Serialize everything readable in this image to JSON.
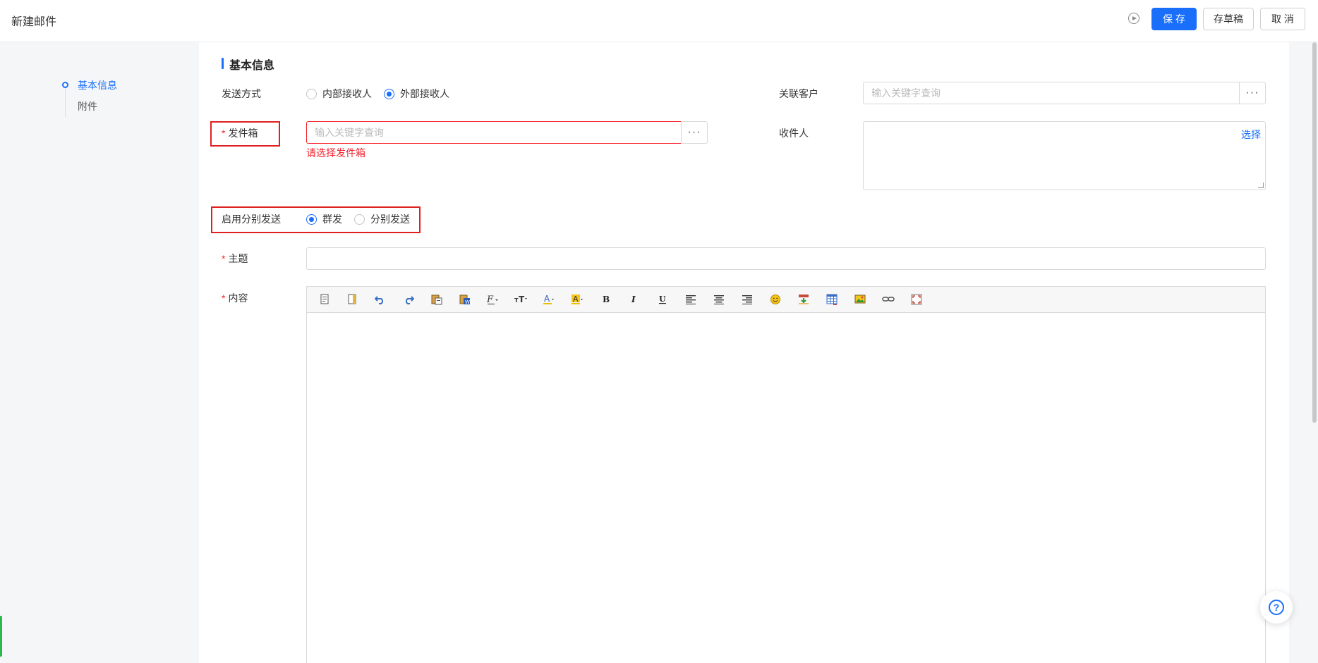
{
  "header": {
    "title": "新建邮件",
    "save_label": "保 存",
    "draft_label": "存草稿",
    "cancel_label": "取 消"
  },
  "anchor_nav": {
    "items": [
      {
        "label": "基本信息",
        "active": true
      },
      {
        "label": "附件",
        "active": false
      }
    ]
  },
  "form": {
    "section_title": "基本信息",
    "send_mode": {
      "label": "发送方式",
      "options": [
        "内部接收人",
        "外部接收人"
      ],
      "selected": "外部接收人"
    },
    "customer": {
      "label": "关联客户",
      "placeholder": "输入关键字查询",
      "more": "···"
    },
    "mailbox": {
      "required_mark": "*",
      "label": "发件箱",
      "placeholder": "输入关键字查询",
      "more": "···",
      "error": "请选择发件箱"
    },
    "recipients": {
      "label": "收件人",
      "select_link": "选择"
    },
    "split_send": {
      "label": "启用分别发送",
      "options": [
        "群发",
        "分别发送"
      ],
      "selected": "群发"
    },
    "subject": {
      "required_mark": "*",
      "label": "主题",
      "value": ""
    },
    "content": {
      "required_mark": "*",
      "label": "内容"
    }
  },
  "editor_toolbar": [
    "source-icon",
    "template-icon",
    "undo-icon",
    "redo-icon",
    "paste-text-icon",
    "paste-word-icon",
    "font-family-icon",
    "font-size-icon",
    "font-color-icon",
    "highlight-color-icon",
    "bold-icon",
    "italic-icon",
    "underline-icon",
    "align-left-icon",
    "align-center-icon",
    "align-right-icon",
    "emoji-icon",
    "insert-table-row-icon",
    "table-icon",
    "image-icon",
    "link-icon",
    "fullscreen-icon"
  ],
  "colors": {
    "primary": "#1a6ffa",
    "error": "#f5222d",
    "highlight_box": "#e02020"
  }
}
